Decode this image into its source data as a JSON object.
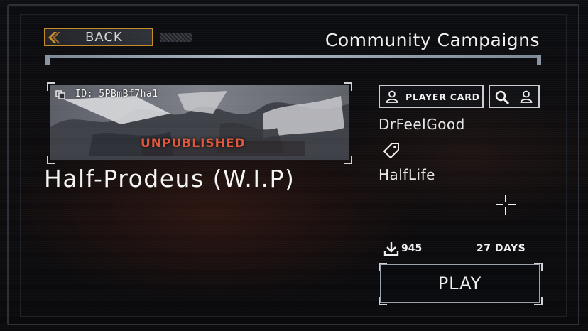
{
  "header": {
    "back_label": "BACK",
    "title": "Community Campaigns"
  },
  "campaign": {
    "id_label": "ID: 5PBmBf7ha1",
    "status": "UNPUBLISHED",
    "title": "Half-Prodeus (W.I.P)",
    "author": "DrFeelGood",
    "tag": "HalfLife",
    "downloads": "945",
    "age": "27 DAYS"
  },
  "actions": {
    "player_card_label": "PLAYER CARD",
    "play_label": "PLAY"
  },
  "colors": {
    "accent_orange": "#c98b2a",
    "status_red": "#e0573c",
    "frame": "#c9ccd2"
  },
  "icons": [
    "chevron-left-icon",
    "copy-icon",
    "user-icon",
    "search-icon",
    "tag-icon",
    "crosshair-icon",
    "download-icon"
  ]
}
